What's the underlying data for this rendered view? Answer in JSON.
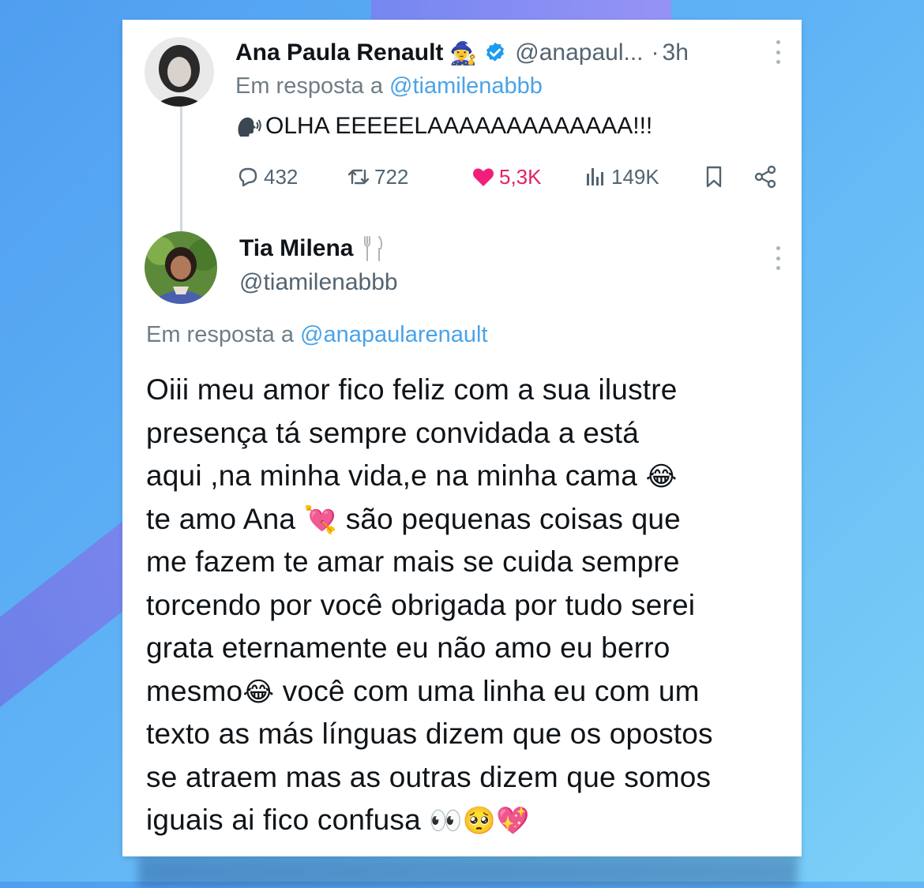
{
  "tweet1": {
    "name": "Ana Paula Renault",
    "name_emoji": "🧙‍♀️",
    "handle": "@anapaul...",
    "dot": "·",
    "time": "3h",
    "reply_prefix": "Em resposta a",
    "reply_mention": "@tiamilenabbb",
    "text": "OLHA EEEEELAAAAAAAAAAAAA!!!",
    "stats": {
      "replies": "432",
      "retweets": "722",
      "likes": "5,3K",
      "views": "149K"
    }
  },
  "tweet2": {
    "name": "Tia Milena",
    "handle": "@tiamilenabbb",
    "reply_prefix": "Em resposta a",
    "reply_mention": "@anapaularenault",
    "lines": [
      {
        "text": "Oiii meu amor fico feliz com a sua ilustre",
        "emoji": ""
      },
      {
        "text": "presença tá sempre convidada a está",
        "emoji": ""
      },
      {
        "text": "aqui ,na minha vida,e na minha cama ",
        "emoji": "😂"
      },
      {
        "text_before": "te amo Ana ",
        "emoji": "💘",
        "text_after": " são pequenas coisas que"
      },
      {
        "text": "me fazem te amar mais se cuida sempre",
        "emoji": ""
      },
      {
        "text": "torcendo por você obrigada por tudo serei",
        "emoji": ""
      },
      {
        "text": "grata eternamente eu não amo eu berro",
        "emoji": ""
      },
      {
        "text_before": "mesmo",
        "emoji": "😂",
        "text_after": " você com uma linha eu com um"
      },
      {
        "text": "texto as más línguas dizem que os opostos",
        "emoji": ""
      },
      {
        "text": "se atraem mas as outras dizem que somos",
        "emoji": ""
      },
      {
        "text": "iguais ai fico confusa ",
        "emoji": "👀🥺💖"
      }
    ]
  }
}
